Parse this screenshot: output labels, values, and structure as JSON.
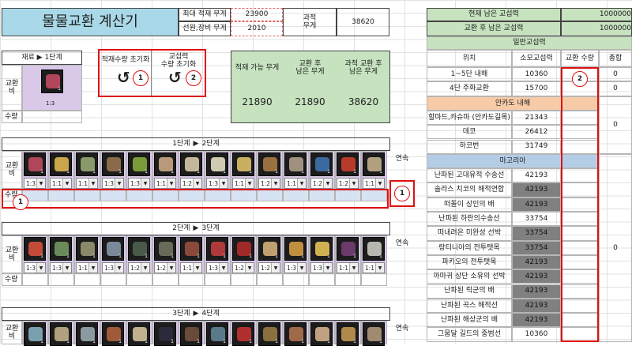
{
  "title": "물물교환 계산기",
  "header": {
    "max_load_label": "최대 적재 무게",
    "max_load_value": "23900",
    "ship_label": "선원,장비 무게",
    "ship_value": "2010",
    "excess_label_1": "과적",
    "excess_label_2": "무게",
    "excess_value": "38620"
  },
  "material": {
    "label": "재료",
    "stage": "1단계",
    "cost_label": "교환비",
    "ratio": "1:3",
    "qty_label": "수량"
  },
  "buttons": {
    "reset_load_label": "적재수량 초기화",
    "reset_trade_label_1": "교섭력",
    "reset_trade_label_2": "수량 초기화",
    "reset_icon": "↺"
  },
  "summary": {
    "headers": [
      "적재 가능 무게",
      "교환 후\n남은 무게",
      "과적 교환 후\n남은 무게"
    ],
    "values": [
      "21890",
      "21890",
      "38620"
    ]
  },
  "stages": [
    {
      "title_from": "1단계",
      "title_to": "2단계",
      "ratios": [
        "1:3",
        "1:1",
        "1:1",
        "1:3",
        "1:3",
        "1:1",
        "1:2",
        "1:3",
        "1:1",
        "1:2",
        "1:1",
        "1:2",
        "1:2",
        "1:1"
      ],
      "icon_colors": [
        "#b0465a",
        "#c9a64a",
        "#8a9a6a",
        "#8a6a4a",
        "#7a9a3a",
        "#b89a7a",
        "#c4b89a",
        "#cfcab0",
        "#c8b060",
        "#9a7040",
        "#a09080",
        "#3a6aa0",
        "#b83a2a",
        "#b0a080"
      ]
    },
    {
      "title_from": "2단계",
      "title_to": "3단계",
      "ratios": [
        "1:3",
        "1:3",
        "1:1",
        "1:3",
        "1:2",
        "1:2",
        "1:1",
        "1:3",
        "1:2",
        "1:2",
        "1:3",
        "1:3",
        "1:1",
        "1:1"
      ],
      "icon_colors": [
        "#c44a3a",
        "#6a8a5a",
        "#8a8a6a",
        "#7a8a9a",
        "#4a5a4a",
        "#6a6a5a",
        "#8a4a3a",
        "#b03a3a",
        "#a02a2a",
        "#c0a070",
        "#c09040",
        "#d0b050",
        "#6a3a6a",
        "#b8b8b0"
      ]
    },
    {
      "title_from": "3단계",
      "title_to": "4단계",
      "icon_colors": [
        "#7aa0b0",
        "#b0a080",
        "#8a9aa0",
        "#a05a3a",
        "#c0b090",
        "#2a2a3a",
        "#6a4a3a",
        "#5a7a8a",
        "#b03030",
        "#8a7040",
        "#a06a4a",
        "#c0a080",
        "#b08a4a",
        "#a08a70"
      ]
    }
  ],
  "labels": {
    "cost": "교환비",
    "qty": "수량",
    "continuous": "연속"
  },
  "right": {
    "remaining_label": "현재 남은 교섭력",
    "remaining_value": "1000000",
    "after_label": "교환 후 남은 교섭력",
    "after_value": "1000000",
    "section_general": "일반교섭력",
    "col_location": "위치",
    "col_cost": "소모교섭력",
    "col_qty": "교환 수량",
    "col_total": "총합",
    "rows": [
      {
        "loc": "1~5단 내해",
        "cost": "10360",
        "total": "0",
        "shade": "",
        "dark": false
      },
      {
        "loc": "4단 주화교환",
        "cost": "15700",
        "total": "0",
        "shade": "",
        "dark": false
      },
      {
        "loc": "안카도 내해",
        "section": true,
        "shade": "peach"
      },
      {
        "loc": "할마드,카슈마 (안카도길목)",
        "cost": "21343",
        "shade": "",
        "dark": false
      },
      {
        "loc": "데코",
        "cost": "26412",
        "total": "0",
        "shade": "",
        "dark": false
      },
      {
        "loc": "하코번",
        "cost": "31749",
        "shade": "",
        "dark": false
      },
      {
        "loc": "마고리아",
        "section": true,
        "shade": "blue"
      },
      {
        "loc": "난파된 고대유적 수송선",
        "cost": "42193",
        "shade": "",
        "dark": false
      },
      {
        "loc": "솔라스 치코의 해적연합",
        "cost": "42193",
        "shade": "",
        "dark": true
      },
      {
        "loc": "떠돌이 상인의 배",
        "cost": "42193",
        "shade": "",
        "dark": true
      },
      {
        "loc": "난파된 하란의수송선",
        "cost": "33754",
        "shade": "",
        "dark": false
      },
      {
        "loc": "떠내려온 미완성 선박",
        "cost": "33754",
        "shade": "",
        "dark": true
      },
      {
        "loc": "랑티니아의 전투탯목",
        "cost": "33754",
        "shade": "",
        "dark": true
      },
      {
        "loc": "파키오의 전투탯목",
        "cost": "42193",
        "shade": "",
        "dark": true
      },
      {
        "loc": "까마귀 상단 소유의 선박",
        "cost": "42193",
        "shade": "",
        "dark": true
      },
      {
        "loc": "난파된 릭군의 배",
        "cost": "42193",
        "shade": "",
        "dark": true
      },
      {
        "loc": "난파된 곡스 해적선",
        "cost": "42193",
        "shade": "",
        "dark": true
      },
      {
        "loc": "난파된 해상군의 배",
        "cost": "42193",
        "shade": "",
        "dark": true
      },
      {
        "loc": "그뭄달 길드의 중범선",
        "cost": "10360",
        "shade": "",
        "dark": false
      }
    ],
    "margoria_total": "0",
    "anchado_total": "0"
  },
  "markers": {
    "one": "1",
    "two": "2"
  }
}
